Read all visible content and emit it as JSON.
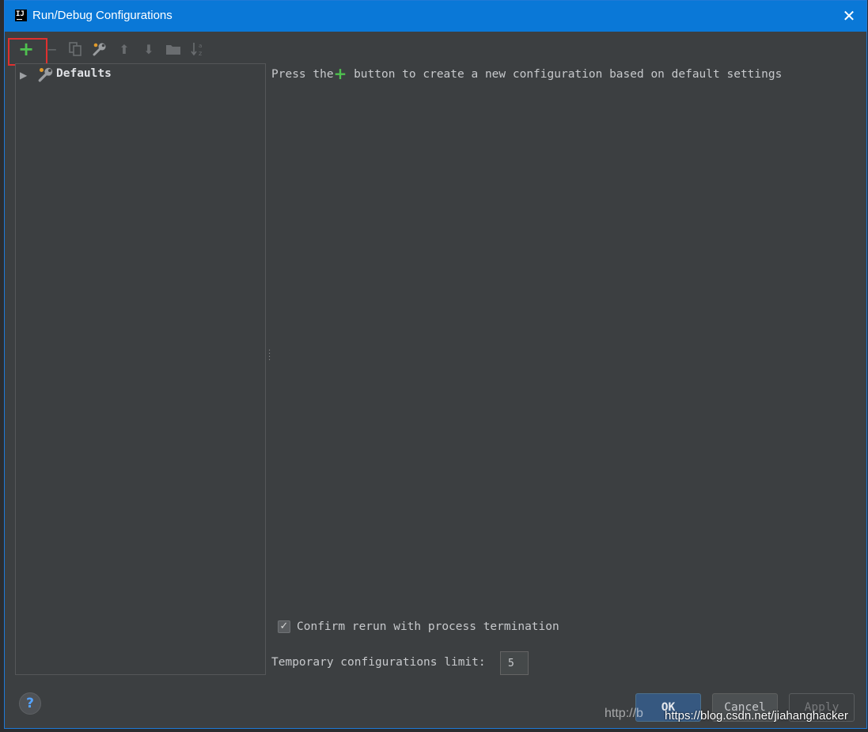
{
  "window": {
    "title": "Run/Debug Configurations",
    "app_icon_text": "IJ",
    "close_glyph": "✕"
  },
  "toolbar": {
    "buttons": [
      {
        "name": "add-icon",
        "glyph": "+",
        "enabled": true
      },
      {
        "name": "remove-icon",
        "glyph": "−",
        "enabled": false
      },
      {
        "name": "copy-icon",
        "glyph": "⧉",
        "enabled": false
      },
      {
        "name": "wrench-icon",
        "glyph": "🔧",
        "enabled": true
      },
      {
        "name": "arrow-up-icon",
        "glyph": "⬆",
        "enabled": false
      },
      {
        "name": "arrow-down-icon",
        "glyph": "⬇",
        "enabled": false
      },
      {
        "name": "folder-icon",
        "glyph": "▬",
        "enabled": false
      },
      {
        "name": "sort-icon",
        "glyph": "↓",
        "enabled": false
      }
    ]
  },
  "tree": {
    "items": [
      {
        "label": "Defaults",
        "expanded": false,
        "icon": "wrench-icon"
      }
    ]
  },
  "main": {
    "hint_before": "Press the",
    "hint_plus": "+",
    "hint_after": " button to create a new configuration based on default settings",
    "confirm_rerun_label": "Confirm rerun with process termination",
    "confirm_rerun_checked": true,
    "temp_limit_label": "Temporary configurations limit:",
    "temp_limit_value": "5"
  },
  "footer": {
    "help_glyph": "?",
    "ok_label": "OK",
    "cancel_label": "Cancel",
    "apply_label": "Apply",
    "apply_enabled": false
  },
  "watermark": {
    "faint": "http://b",
    "text": "https://blog.csdn.net/jiahanghacker"
  },
  "colors": {
    "titlebar": "#0a78d7",
    "dialog_bg": "#3c3f41",
    "add_green": "#4fc14f",
    "highlight_red": "#e0302f",
    "help_blue": "#54a3ff"
  }
}
